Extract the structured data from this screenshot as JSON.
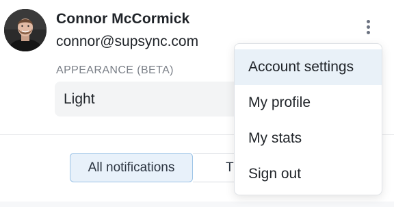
{
  "profile": {
    "name": "Connor McCormick",
    "email": "connor@supsync.com",
    "avatar_icon": "user-photo"
  },
  "appearance": {
    "label": "APPEARANCE (BETA)",
    "selected": "Light"
  },
  "notifications": {
    "tabs": [
      {
        "label": "All notifications",
        "selected": true
      },
      {
        "label": "T",
        "selected": false
      }
    ]
  },
  "menu": {
    "trigger_icon": "kebab-vertical-icon",
    "items": [
      {
        "label": "Account settings",
        "highlighted": true
      },
      {
        "label": "My profile"
      },
      {
        "label": "My stats"
      },
      {
        "label": "Sign out"
      }
    ]
  },
  "colors": {
    "highlight": "#e9f1f8",
    "tab_selected_bg": "#e8f1fa",
    "tab_selected_border": "#9cc3e6",
    "muted_text": "#7a7f87"
  }
}
